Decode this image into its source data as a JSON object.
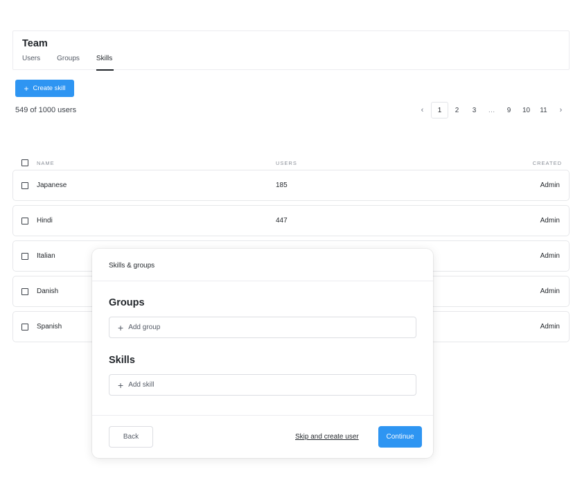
{
  "header": {
    "title": "Team",
    "tabs": [
      {
        "label": "Users",
        "active": false
      },
      {
        "label": "Groups",
        "active": false
      },
      {
        "label": "Skills",
        "active": true
      }
    ]
  },
  "toolbar": {
    "create_label": "Create skill",
    "create_icon": "plus-icon"
  },
  "summary": {
    "count_text": "549 of 1000 users"
  },
  "pagination": {
    "prev_icon": "‹",
    "pages": [
      "1",
      "2",
      "3",
      "…",
      "9",
      "10",
      "11"
    ],
    "current": "1",
    "next_icon": "›"
  },
  "table": {
    "columns": {
      "name": "NAME",
      "users": "USERS",
      "created": "CREATED"
    },
    "rows": [
      {
        "name": "Japanese",
        "users": "185",
        "created": "Admin"
      },
      {
        "name": "Hindi",
        "users": "447",
        "created": "Admin"
      },
      {
        "name": "Italian",
        "users": "",
        "created": "Admin"
      },
      {
        "name": "Danish",
        "users": "",
        "created": "Admin"
      },
      {
        "name": "Spanish",
        "users": "",
        "created": "Admin"
      }
    ]
  },
  "modal": {
    "title": "Skills & groups",
    "groups_heading": "Groups",
    "add_group_label": "Add group",
    "skills_heading": "Skills",
    "add_skill_label": "Add skill",
    "back_label": "Back",
    "skip_label": "Skip and create user",
    "continue_label": "Continue"
  },
  "colors": {
    "accent": "#2e95f2",
    "text": "#1f2328",
    "border": "#e6e7ea"
  }
}
